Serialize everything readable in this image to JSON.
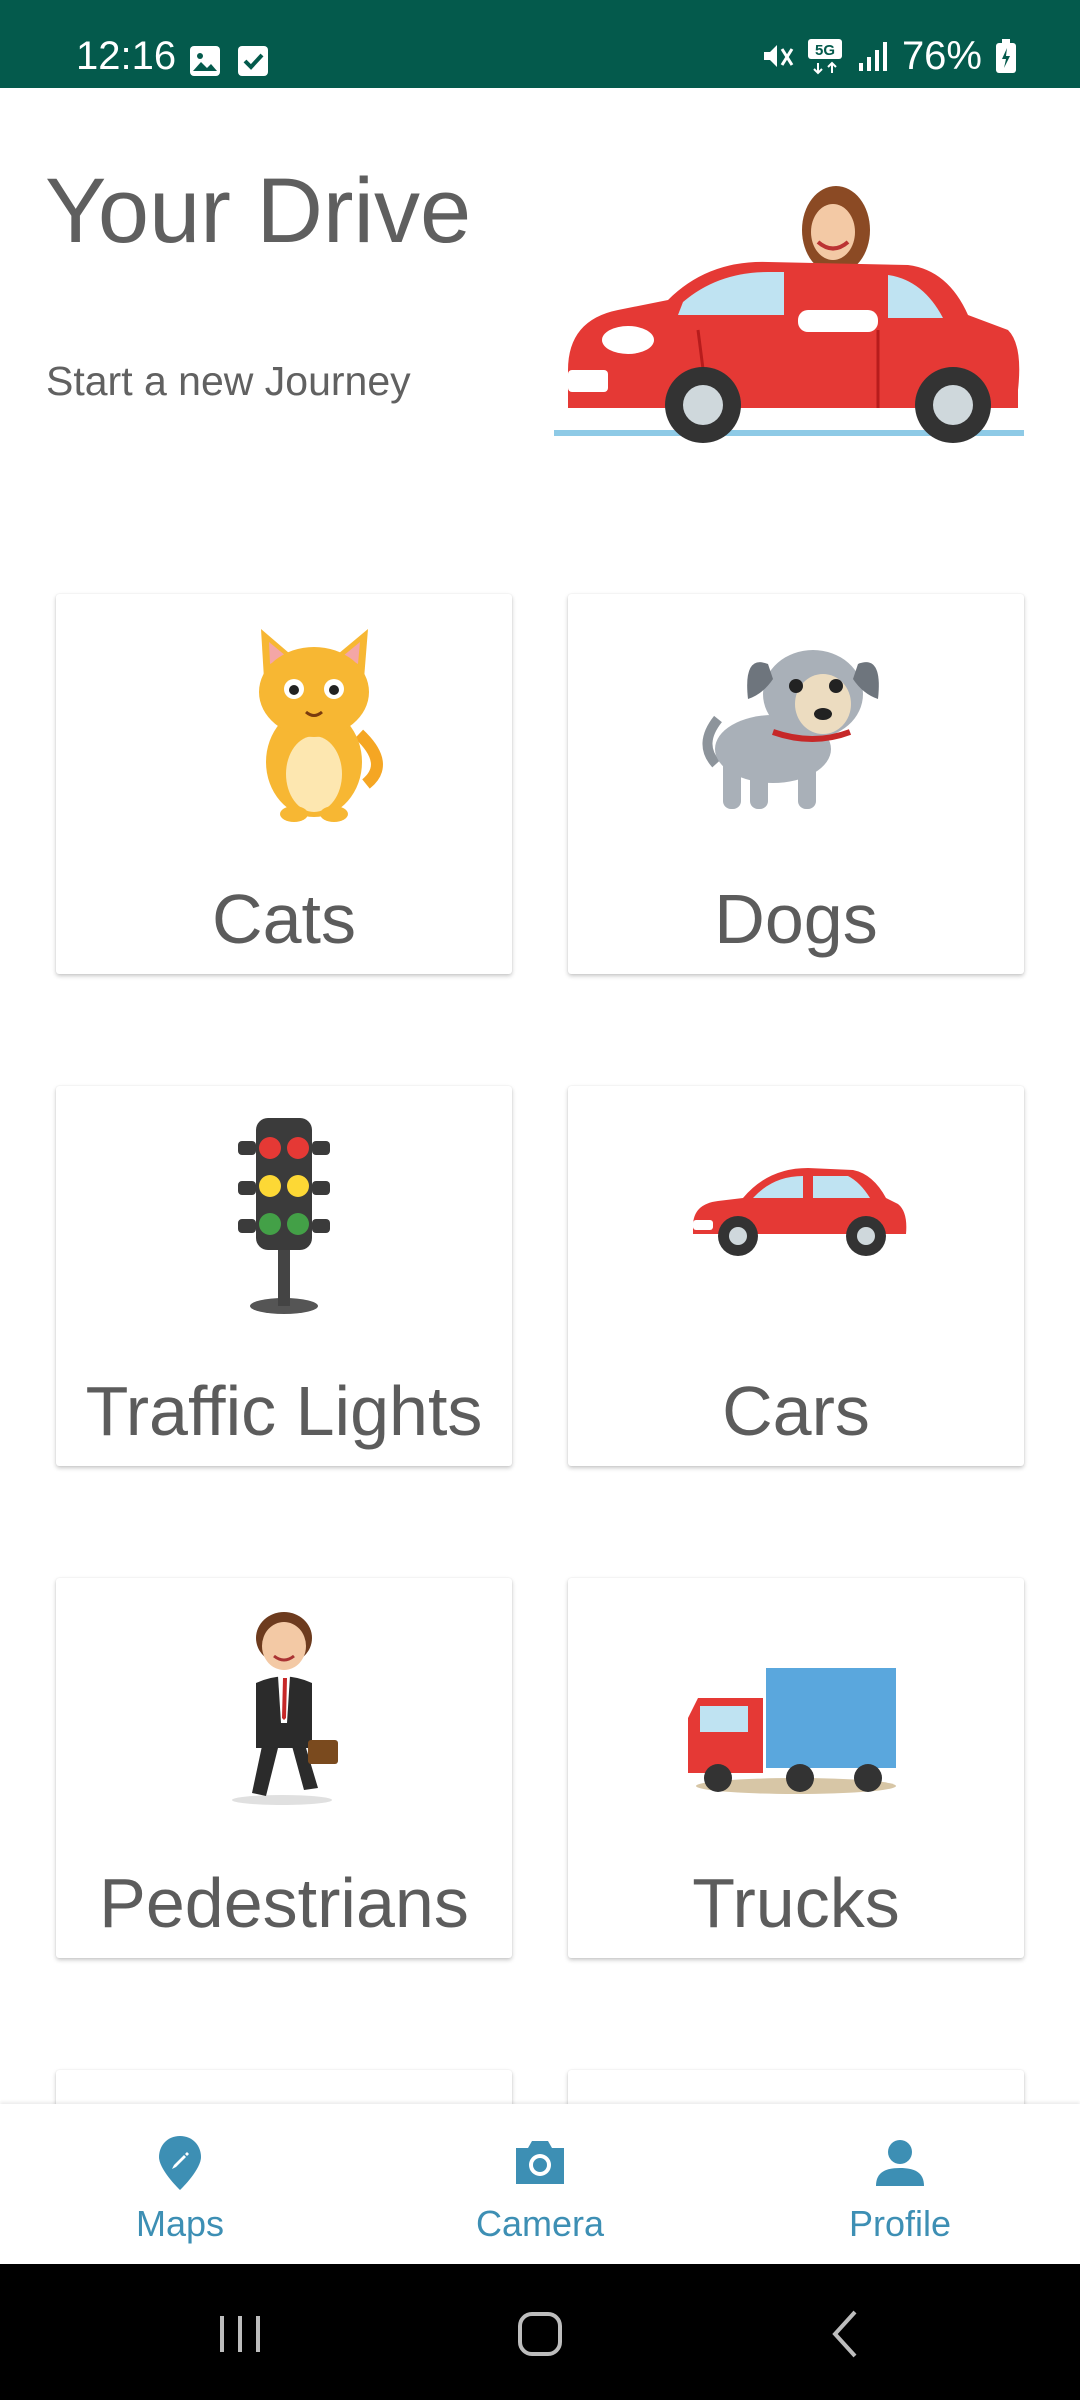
{
  "status_bar": {
    "time": "12:16",
    "battery": "76%",
    "icons_left": [
      "gallery-icon",
      "checkbox-icon"
    ],
    "icons_right": [
      "mute-vibrate-icon",
      "5g-icon",
      "signal-icon",
      "battery-icon"
    ]
  },
  "header": {
    "title": "Your Drive",
    "subtitle": "Start a new Journey"
  },
  "categories": [
    {
      "label": "Cats",
      "icon": "cat-illustration"
    },
    {
      "label": "Dogs",
      "icon": "dog-illustration"
    },
    {
      "label": "Traffic Lights",
      "icon": "traffic-light-illustration"
    },
    {
      "label": "Cars",
      "icon": "car-illustration"
    },
    {
      "label": "Pedestrians",
      "icon": "pedestrian-illustration"
    },
    {
      "label": "Trucks",
      "icon": "truck-illustration"
    }
  ],
  "bottom_nav": {
    "items": [
      {
        "label": "Maps",
        "icon": "map-pin-icon"
      },
      {
        "label": "Camera",
        "icon": "camera-icon"
      },
      {
        "label": "Profile",
        "icon": "person-icon"
      }
    ],
    "accent": "#3d8fb4"
  },
  "colors": {
    "status_bar": "#045a4c",
    "card_text": "#5c5c5c"
  }
}
